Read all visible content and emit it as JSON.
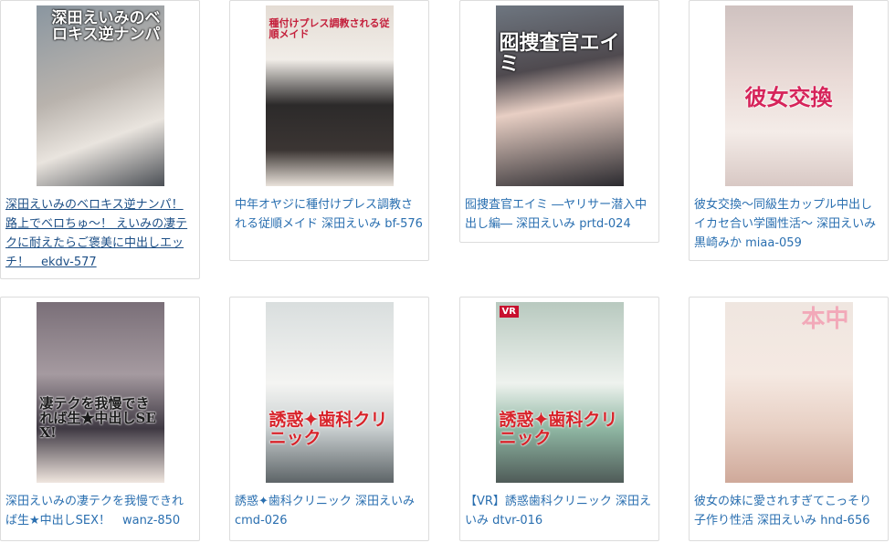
{
  "items": [
    {
      "title": "深田えいみのベロキス逆ナンパ！路上でベロちゅ～！ えいみの凄テクに耐えたらご褒美に中出しエッチ！　ekdv-577",
      "cover_text": "深田えいみのベロキス逆ナンパ",
      "tone": "#6f7f8c",
      "visited": true
    },
    {
      "title": "中年オヤジに種付けプレス調教される従順メイド 深田えいみ bf-576",
      "cover_text": "種付けプレス調教される従順メイド",
      "tone": "#2c2a2a",
      "visited": false
    },
    {
      "title": "囮捜査官エイミ ―ヤリサー潜入中出し編― 深田えいみ prtd-024",
      "cover_text": "囮捜査官エイミ",
      "tone": "#5e5a60",
      "visited": false
    },
    {
      "title": "彼女交換～同級生カップル中出しイカセ合い学園性活～ 深田えいみ 黒崎みか miaa-059",
      "cover_text": "彼女交換",
      "tone": "#d9c7c5",
      "visited": false
    },
    {
      "title": "深田えいみの凄テクを我慢できれば生★中出しSEX！　wanz-850",
      "cover_text": "凄テクを我慢できれば生★中出しSEX!",
      "tone": "#6b5f6a",
      "visited": false
    },
    {
      "title": "誘惑✦歯科クリニック 深田えいみ cmd-026",
      "cover_text": "誘惑✦歯科クリニック",
      "tone": "#cfd6d6",
      "visited": false
    },
    {
      "title": "【VR】誘惑歯科クリニック 深田えいみ dtvr-016",
      "cover_text": "誘惑✦歯科クリニック",
      "tone": "#9fb6a6",
      "visited": false
    },
    {
      "title": "彼女の妹に愛されすぎてこっそり子作り性活 深田えいみ hnd-656",
      "cover_text": "本中",
      "tone": "#e6d2c8",
      "visited": false
    }
  ],
  "badges": {
    "vr": "VR"
  }
}
